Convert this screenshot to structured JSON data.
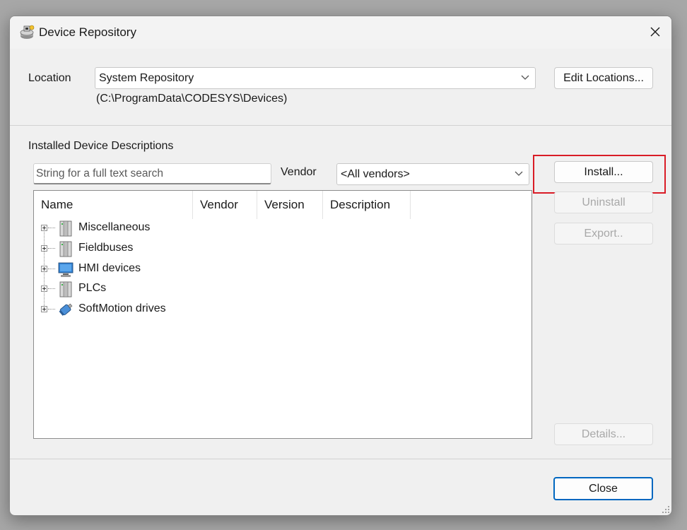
{
  "window": {
    "title": "Device Repository",
    "close_glyph": "✕",
    "app_icon": "device-repository-icon"
  },
  "location": {
    "label": "Location",
    "selected": "System Repository",
    "path": "(C:\\ProgramData\\CODESYS\\Devices)",
    "edit_button": "Edit Locations..."
  },
  "installed": {
    "section_label": "Installed Device Descriptions",
    "search_placeholder": "String for a full text search",
    "vendor_label": "Vendor",
    "vendor_selected": "<All vendors>",
    "columns": [
      "Name",
      "Vendor",
      "Version",
      "Description"
    ],
    "tree": [
      {
        "label": "Miscellaneous",
        "icon": "device-module-icon"
      },
      {
        "label": "Fieldbuses",
        "icon": "device-module-icon"
      },
      {
        "label": "HMI devices",
        "icon": "monitor-icon"
      },
      {
        "label": "PLCs",
        "icon": "device-module-icon"
      },
      {
        "label": "SoftMotion drives",
        "icon": "motor-drive-icon"
      }
    ]
  },
  "buttons": {
    "install": "Install...",
    "uninstall": "Uninstall",
    "export": "Export..",
    "details": "Details...",
    "close": "Close"
  },
  "colors": {
    "highlight": "#d91c26",
    "primary_border": "#0067c0",
    "dialog_bg": "#f0f0f0"
  }
}
